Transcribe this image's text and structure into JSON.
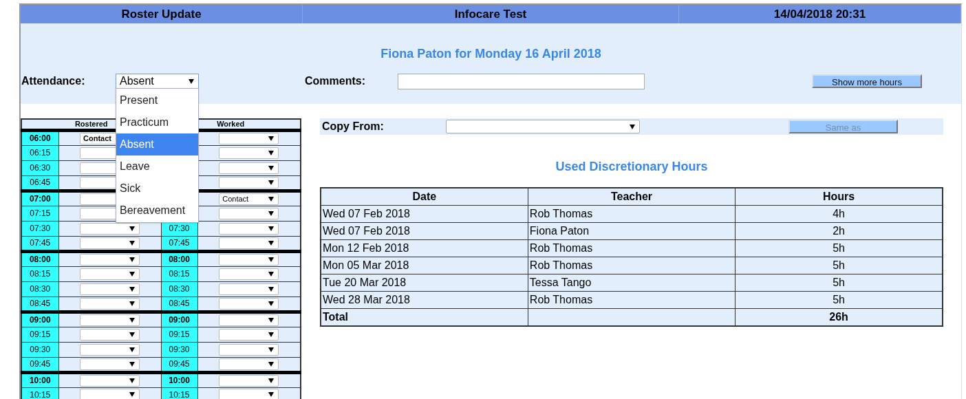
{
  "header": {
    "cells": [
      "Roster Update",
      "Infocare Test",
      "14/04/2018 20:31"
    ]
  },
  "page_title": "Fiona Paton for Monday 16 April 2018",
  "attendance": {
    "label": "Attendance:",
    "value": "Absent",
    "expanded": true,
    "options": [
      {
        "label": "Present",
        "selected": false
      },
      {
        "label": "Practicum",
        "selected": false
      },
      {
        "label": "Absent",
        "selected": true
      },
      {
        "label": "Leave",
        "selected": false
      },
      {
        "label": "Sick",
        "selected": false
      },
      {
        "label": "Bereavement",
        "selected": false
      }
    ]
  },
  "comments": {
    "label": "Comments:"
  },
  "show_more_button": "Show more hours",
  "roster": {
    "columns": [
      "Rostered",
      "Worked"
    ],
    "rows": [
      {
        "kind": "hour",
        "time": "06:00",
        "rostered": "Contact"
      },
      {
        "kind": "quarter",
        "time": "06:15"
      },
      {
        "kind": "quarter",
        "time": "06:30"
      },
      {
        "kind": "quarter",
        "time": "06:45"
      },
      {
        "kind": "hour",
        "time": "07:00",
        "worked": "Contact"
      },
      {
        "kind": "quarter",
        "time": "07:15"
      },
      {
        "kind": "quarter",
        "time": "07:30",
        "time_2": "07:30"
      },
      {
        "kind": "quarter",
        "time": "07:45",
        "time_2": "07:45"
      },
      {
        "kind": "hour",
        "time": "08:00",
        "time_2": "08:00"
      },
      {
        "kind": "quarter",
        "time": "08:15",
        "time_2": "08:15"
      },
      {
        "kind": "quarter",
        "time": "08:30",
        "time_2": "08:30"
      },
      {
        "kind": "quarter",
        "time": "08:45",
        "time_2": "08:45"
      },
      {
        "kind": "hour",
        "time": "09:00",
        "time_2": "09:00"
      },
      {
        "kind": "quarter",
        "time": "09:15",
        "time_2": "09:15"
      },
      {
        "kind": "quarter",
        "time": "09:30",
        "time_2": "09:30"
      },
      {
        "kind": "quarter",
        "time": "09:45",
        "time_2": "09:45"
      },
      {
        "kind": "hour",
        "time": "10:00",
        "time_2": "10:00"
      },
      {
        "kind": "quarter",
        "time": "10:15",
        "time_2": "10:15"
      }
    ]
  },
  "copy_from": {
    "label": "Copy From:"
  },
  "same_as_button": {
    "label": "Same as",
    "disabled": true
  },
  "discretionary": {
    "title": "Used Discretionary Hours",
    "columns": [
      "Date",
      "Teacher",
      "Hours"
    ],
    "rows": [
      {
        "date": "Wed 07 Feb 2018",
        "teacher": "Rob Thomas",
        "hours": "4h"
      },
      {
        "date": "Wed 07 Feb 2018",
        "teacher": "Fiona Paton",
        "hours": "2h"
      },
      {
        "date": "Mon 12 Feb 2018",
        "teacher": "Rob Thomas",
        "hours": "5h"
      },
      {
        "date": "Mon 05 Mar 2018",
        "teacher": "Rob Thomas",
        "hours": "5h"
      },
      {
        "date": "Tue 20 Mar 2018",
        "teacher": "Tessa Tango",
        "hours": "5h"
      },
      {
        "date": "Wed 28 Mar 2018",
        "teacher": "Rob Thomas",
        "hours": "5h"
      }
    ],
    "total": {
      "label": "Total",
      "hours": "26h"
    }
  }
}
